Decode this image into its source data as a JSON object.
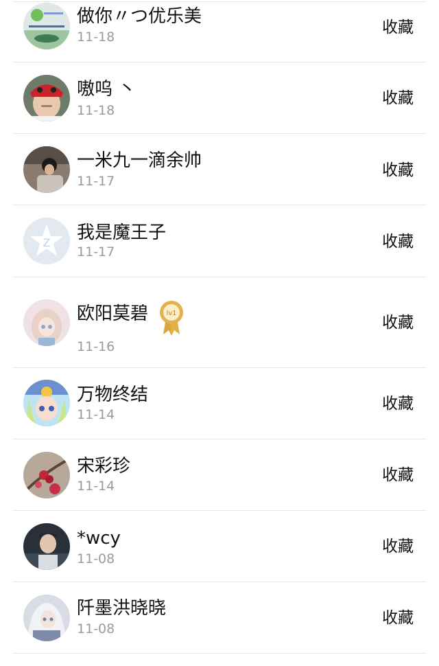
{
  "contacts": [
    {
      "name": "做你〃つ优乐美",
      "date": "11-18",
      "action": "收藏",
      "avatar": "wechat-landscape-avatar"
    },
    {
      "name": "嗷呜 丶",
      "date": "11-18",
      "action": "收藏",
      "avatar": "boy-red-hat-avatar"
    },
    {
      "name": "一米九一滴余帅",
      "date": "11-17",
      "action": "收藏",
      "avatar": "boy-sitting-avatar"
    },
    {
      "name": "我是魔王子",
      "date": "11-17",
      "action": "收藏",
      "avatar": "default-qzone-star-avatar"
    },
    {
      "name": "欧阳莫碧",
      "date": "11-16",
      "action": "收藏",
      "avatar": "anime-girl-avatar",
      "badge": "lv1"
    },
    {
      "name": "万物终结",
      "date": "11-14",
      "action": "收藏",
      "avatar": "anime-character-avatar"
    },
    {
      "name": "宋彩珍",
      "date": "11-14",
      "action": "收藏",
      "avatar": "red-flowers-avatar"
    },
    {
      "name": "*wcy",
      "date": "11-08",
      "action": "收藏",
      "avatar": "boy-photo-avatar"
    },
    {
      "name": "阡墨洪晓晓",
      "date": "11-08",
      "action": "收藏",
      "avatar": "anime-white-hair-avatar"
    }
  ],
  "colors": {
    "date_gray": "#9a9a9a",
    "separator": "#e6e6e6",
    "badge_gold": "#d9a63c"
  }
}
